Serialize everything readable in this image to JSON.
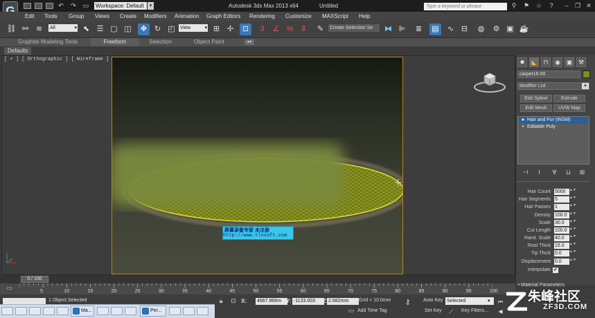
{
  "title_bar": {
    "workspace": "Workspace: Default",
    "app_title": "Autodesk 3ds Max  2013 x64",
    "doc_title": "Untitled",
    "search_placeholder": "Type a keyword or phrase"
  },
  "menu": [
    "Edit",
    "Tools",
    "Group",
    "Views",
    "Create",
    "Modifiers",
    "Animation",
    "Graph Editors",
    "Rendering",
    "Customize",
    "MAXScript",
    "Help"
  ],
  "toolbar": {
    "selection_filter": "All",
    "ref_coord": "View",
    "named_selection": "Create Selection Se",
    "icons": [
      "link-icon",
      "unlink-icon",
      "bind-space-warp-icon",
      "select-object-icon",
      "select-by-name-icon",
      "rect-selection-icon",
      "window-crossing-icon",
      "move-icon",
      "rotate-icon",
      "scale-icon",
      "pivot-icon",
      "select-manipulate-icon",
      "keyboard-shortcut-icon",
      "snap-3-icon",
      "angle-snap-icon",
      "percent-snap-icon",
      "spinner-snap-icon",
      "edit-named-sets-icon",
      "mirror-icon",
      "align-icon",
      "layer-manager-icon",
      "ribbon-toggle-icon",
      "curve-editor-icon",
      "schematic-view-icon",
      "material-editor-icon",
      "render-setup-icon",
      "rendered-frame-icon",
      "render-icon"
    ],
    "snap_label": "3",
    "percent_label": "%"
  },
  "ribbon": {
    "tabs": [
      "Graphite Modeling Tools",
      "Freeform",
      "Selection",
      "Object Paint"
    ],
    "active_tab": "Freeform",
    "panel_tab": "Defaults"
  },
  "viewport": {
    "label": "[ + ] [ Orthographic ] [ Wireframe ]"
  },
  "command_panel": {
    "tab_icons": [
      "create-icon",
      "modify-icon",
      "hierarchy-icon",
      "motion-icon",
      "display-icon",
      "utilities-icon"
    ],
    "object_name": "carpet16-00",
    "object_color": "#7a8f1e",
    "modifier_list": "Modifier List",
    "buttons": [
      "Edit Spline",
      "Extrude",
      "Edit Mesh",
      "UVW Map"
    ],
    "stack": [
      "Hair and Fur (WSM)",
      "Editable Poly"
    ],
    "params": [
      {
        "label": "Hair Count",
        "value": "5000"
      },
      {
        "label": "Hair Segments",
        "value": "5"
      },
      {
        "label": "Hair Passes",
        "value": "1"
      },
      {
        "label": "Density",
        "value": "100.0"
      },
      {
        "label": "Scale",
        "value": "30.0"
      },
      {
        "label": "Cut Length",
        "value": "100.0"
      },
      {
        "label": "Rand. Scale",
        "value": "40.0"
      },
      {
        "label": "Root Thick",
        "value": "15.0"
      },
      {
        "label": "Tip Thick",
        "value": "0.0"
      },
      {
        "label": "Displacement",
        "value": "0.0"
      }
    ],
    "interpolate_label": "Interpolate",
    "interpolate_mark": "✔",
    "material_params": "Material Parameters"
  },
  "timeline": {
    "slider_label": "0 / 100",
    "ticks": [
      "5",
      "10",
      "15",
      "20",
      "25",
      "30",
      "35",
      "40",
      "45",
      "50",
      "55",
      "60",
      "65",
      "70",
      "75",
      "80",
      "85",
      "90",
      "95",
      "100"
    ]
  },
  "status": {
    "selected": "1 Object Selected",
    "x_label": "X:",
    "x_value": "4667.966m",
    "y_label": "Y:",
    "y_value": "-1133.003",
    "z_label": "Z:",
    "z_value": "2.682mm",
    "grid": "Grid = 10.0mm",
    "add_time_tag": "Add Time Tag",
    "auto_key": "Auto Key",
    "set_key": "Set Key",
    "selection_mode": "Selected",
    "key_filters": "Key Filters..."
  },
  "taskbar": {
    "items": [
      "Ma...",
      "Per..."
    ]
  },
  "watermarks": {
    "recorder_line1": "屏幕录像专家      未注册",
    "recorder_line2": "http://www.tlxsoft.com",
    "site_name": "朱峰社区",
    "site_url": "ZF3D.COM"
  }
}
